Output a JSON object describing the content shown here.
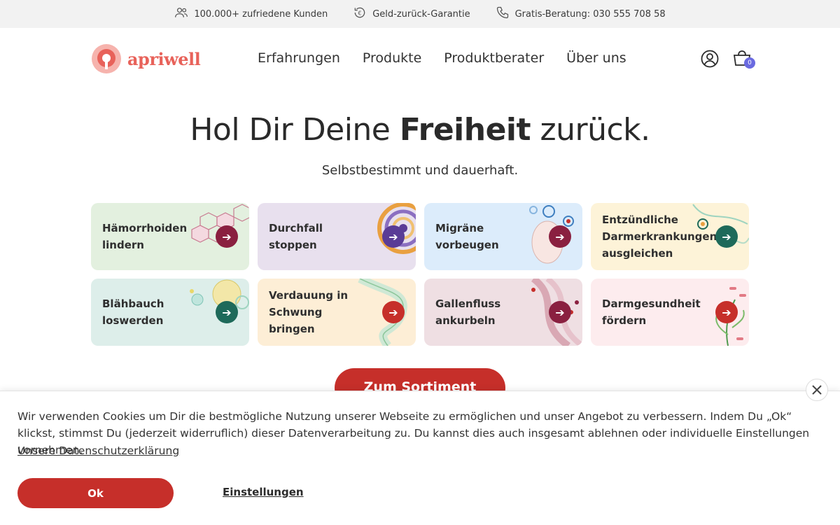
{
  "topbar": {
    "customers": "100.000+ zufriedene Kunden",
    "guarantee": "Geld-zurück-Garantie",
    "consult": "Gratis-Beratung: 030 555 708 58"
  },
  "header": {
    "logo_text": "apriwell",
    "nav": [
      "Erfahrungen",
      "Produkte",
      "Produktberater",
      "Über uns"
    ],
    "cart_count": "0"
  },
  "hero": {
    "title_pre": "Hol Dir Deine ",
    "title_bold": "Freiheit",
    "title_post": " zurück.",
    "subtitle": "Selbstbestimmt und dauerhaft."
  },
  "cards": [
    {
      "label": "Hämorrhoiden lindern",
      "bg": "#e3f0df",
      "accent": "#8a2040",
      "icon": "honeycomb-illustration"
    },
    {
      "label": "Durchfall stoppen",
      "bg": "#e8e0ee",
      "accent": "#5a3c96",
      "icon": "swirl-illustration"
    },
    {
      "label": "Migräne vorbeugen",
      "bg": "#dcecfb",
      "accent": "#8a2040",
      "icon": "face-illustration"
    },
    {
      "label": "Entzündliche Darmerkrankungen ausgleichen",
      "bg": "#fdf3d8",
      "accent": "#1e6a5a",
      "icon": "cells-illustration"
    },
    {
      "label": "Blähbauch loswerden",
      "bg": "#ddeeea",
      "accent": "#1e6a5a",
      "icon": "bubbles-illustration"
    },
    {
      "label": "Verdauung in Schwung bringen",
      "bg": "#fdeed6",
      "accent": "#c62f2a",
      "icon": "intestine-illustration"
    },
    {
      "label": "Gallenfluss ankurbeln",
      "bg": "#efdfe3",
      "accent": "#8a2040",
      "icon": "molecule-illustration"
    },
    {
      "label": "Darmgesundheit fördern",
      "bg": "#fdecee",
      "accent": "#c62f2a",
      "icon": "plant-illustration"
    }
  ],
  "cta": {
    "label": "Zum Sortiment"
  },
  "cookie": {
    "text": "Wir verwenden Cookies um Dir die bestmögliche Nutzung unserer Webseite zu ermöglichen und unser Angebot zu verbessern. Indem Du „Ok“ klickst, stimmst Du (jederzeit widerruflich) dieser Datenverarbeitung zu. Du kannst dies auch insgesamt ablehnen oder individuelle Einstellungen vornehmen.",
    "privacy_link": "Unsere Datenschutzerklärung",
    "ok_label": "Ok",
    "settings_label": "Einstellungen"
  },
  "colors": {
    "brand": "#e8625a",
    "primary_button": "#c62f2a",
    "badge": "#6a6ae0"
  }
}
